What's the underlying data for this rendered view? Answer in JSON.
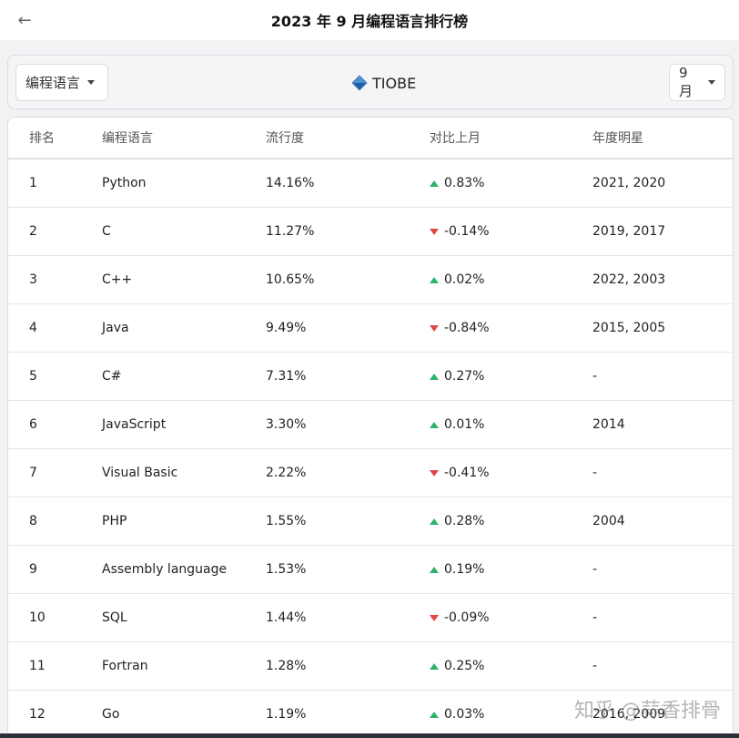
{
  "header": {
    "title": "2023 年 9 月编程语言排行榜",
    "back_icon": "arrow-left-icon"
  },
  "filters": {
    "language_label": "编程语言",
    "source_label": "TIOBE",
    "source_icon": "diamond-icon",
    "month_label": "9月"
  },
  "table": {
    "columns": [
      "排名",
      "编程语言",
      "流行度",
      "对比上月",
      "年度明星"
    ],
    "rows": [
      {
        "rank": "1",
        "language": "Python",
        "popularity": "14.16%",
        "change": "0.83%",
        "direction": "up",
        "star": "2021, 2020"
      },
      {
        "rank": "2",
        "language": "C",
        "popularity": "11.27%",
        "change": "-0.14%",
        "direction": "down",
        "star": "2019, 2017"
      },
      {
        "rank": "3",
        "language": "C++",
        "popularity": "10.65%",
        "change": "0.02%",
        "direction": "up",
        "star": "2022, 2003"
      },
      {
        "rank": "4",
        "language": "Java",
        "popularity": "9.49%",
        "change": "-0.84%",
        "direction": "down",
        "star": "2015, 2005"
      },
      {
        "rank": "5",
        "language": "C#",
        "popularity": "7.31%",
        "change": "0.27%",
        "direction": "up",
        "star": "-"
      },
      {
        "rank": "6",
        "language": "JavaScript",
        "popularity": "3.30%",
        "change": "0.01%",
        "direction": "up",
        "star": "2014"
      },
      {
        "rank": "7",
        "language": "Visual Basic",
        "popularity": "2.22%",
        "change": "-0.41%",
        "direction": "down",
        "star": "-"
      },
      {
        "rank": "8",
        "language": "PHP",
        "popularity": "1.55%",
        "change": "0.28%",
        "direction": "up",
        "star": "2004"
      },
      {
        "rank": "9",
        "language": "Assembly language",
        "popularity": "1.53%",
        "change": "0.19%",
        "direction": "up",
        "star": "-"
      },
      {
        "rank": "10",
        "language": "SQL",
        "popularity": "1.44%",
        "change": "-0.09%",
        "direction": "down",
        "star": "-"
      },
      {
        "rank": "11",
        "language": "Fortran",
        "popularity": "1.28%",
        "change": "0.25%",
        "direction": "up",
        "star": "-"
      },
      {
        "rank": "12",
        "language": "Go",
        "popularity": "1.19%",
        "change": "0.03%",
        "direction": "up",
        "star": "2016, 2009"
      }
    ]
  },
  "watermark": "知乎 @蒜香排骨",
  "colors": {
    "up": "#2fb36b",
    "down": "#e04848"
  }
}
